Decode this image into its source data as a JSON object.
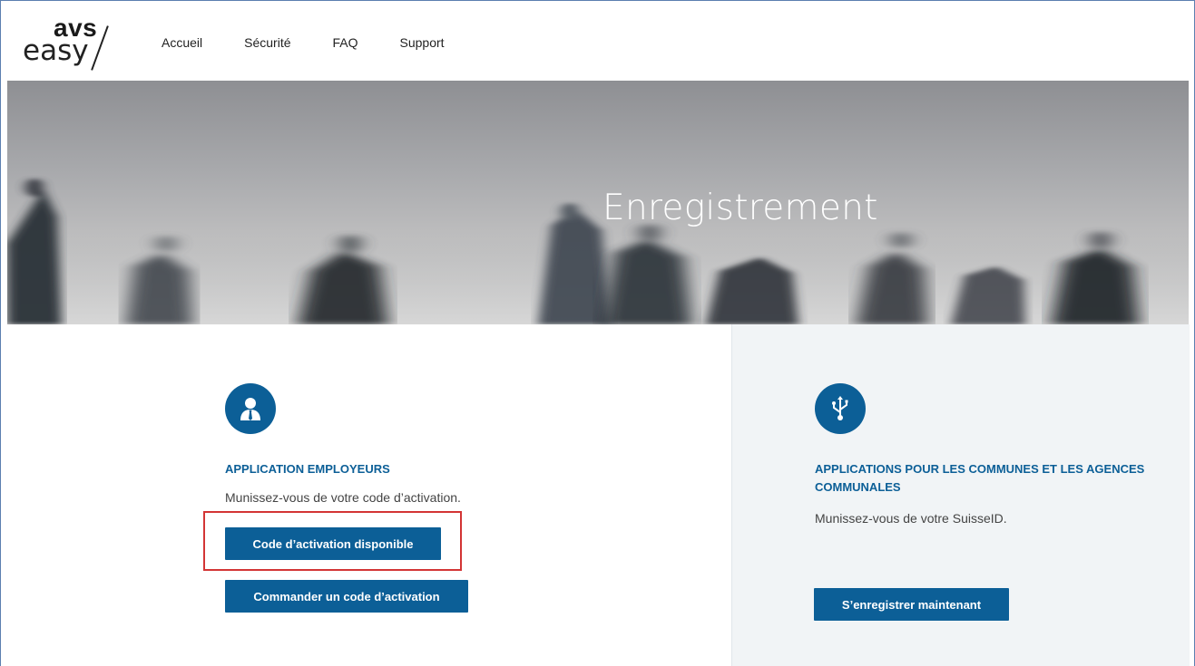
{
  "logo": {
    "top": "avs",
    "bottom": "easy"
  },
  "nav": {
    "items": [
      "Accueil",
      "Sécurité",
      "FAQ",
      "Support"
    ]
  },
  "hero": {
    "title": "Enregistrement"
  },
  "employers": {
    "icon": "employer-person-icon",
    "title": "APPLICATION EMPLOYEURS",
    "text": "Munissez-vous de votre code d’activation.",
    "primary_button": "Code d’activation disponible",
    "secondary_button": "Commander un code d’activation"
  },
  "communes": {
    "icon": "usb-icon",
    "title_line1": "APPLICATIONS POUR LES COMMUNES ET LES AGENCES",
    "title_line2": "COMMUNALES",
    "text": "Munissez-vous de votre SuisseID.",
    "button": "S’enregistrer maintenant"
  },
  "colors": {
    "brand_blue": "#0c5f97",
    "highlight_red": "#d33535",
    "panel_gray": "#f1f4f6"
  }
}
